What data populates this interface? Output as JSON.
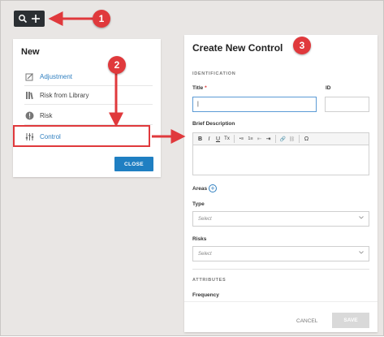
{
  "new_panel": {
    "title": "New",
    "items": [
      {
        "label": "Adjustment",
        "icon": "adjustment-icon"
      },
      {
        "label": "Risk from Library",
        "icon": "library-icon"
      },
      {
        "label": "Risk",
        "icon": "risk-icon"
      },
      {
        "label": "Control",
        "icon": "control-icon"
      }
    ],
    "close_label": "CLOSE"
  },
  "create_panel": {
    "title": "Create New Control",
    "identification_label": "IDENTIFICATION",
    "title_label": "Title",
    "required_mark": "*",
    "title_value": "|",
    "id_label": "ID",
    "description_label": "Brief Description",
    "toolbar": [
      "B",
      "I",
      "U",
      "Tx",
      "•≡",
      "1≡",
      "⇤",
      "⇥",
      "🔗",
      "⛓",
      "Ω"
    ],
    "areas_label": "Areas",
    "type_label": "Type",
    "type_placeholder": "Select",
    "risks_label": "Risks",
    "risks_placeholder": "Select",
    "attributes_label": "ATTRIBUTES",
    "frequency_label": "Frequency",
    "cancel_label": "CANCEL",
    "save_label": "SAVE"
  },
  "annotations": [
    "1",
    "2",
    "3"
  ],
  "colors": {
    "accent": "#1f7fc2",
    "annotation_red": "#e0393c",
    "toolbar_dark": "#2b2f33",
    "background": "#e9e6e4"
  }
}
